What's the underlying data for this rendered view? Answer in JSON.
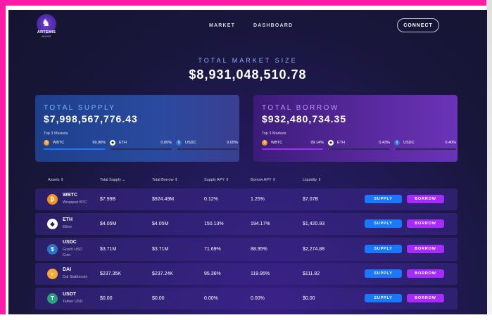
{
  "brand": {
    "name": "ARTEMIS",
    "sub": "ADLANT"
  },
  "nav": {
    "market": "MARKET",
    "dashboard": "DASHBOARD"
  },
  "connect_label": "CONNECT",
  "total_market": {
    "label": "TOTAL MARKET SIZE",
    "value": "$8,931,048,510.78"
  },
  "supply_card": {
    "title": "TOTAL SUPPLY",
    "value": "$7,998,567,776.43",
    "top3_label": "Top 3 Markets",
    "markets": [
      {
        "name": "WBTC",
        "pct": "99.90%",
        "fill": 0.999,
        "icon": "bitcoin-icon"
      },
      {
        "name": "ETH",
        "pct": "0.05%",
        "fill": 0.0005,
        "icon": "ethereum-icon"
      },
      {
        "name": "USDC",
        "pct": "0.05%",
        "fill": 0.0005,
        "icon": "usdc-icon"
      }
    ]
  },
  "borrow_card": {
    "title": "TOTAL BORROW",
    "value": "$932,480,734.35",
    "top3_label": "Top 3 Markets",
    "markets": [
      {
        "name": "WBTC",
        "pct": "99.14%",
        "fill": 0.9914,
        "icon": "bitcoin-icon"
      },
      {
        "name": "ETH",
        "pct": "0.43%",
        "fill": 0.0043,
        "icon": "ethereum-icon"
      },
      {
        "name": "USDC",
        "pct": "0.40%",
        "fill": 0.004,
        "icon": "usdc-icon"
      }
    ]
  },
  "table": {
    "headers": [
      "Assets ⇕",
      "Total Supply ⌄",
      "Total Borrow ⇕",
      "Supply APY ⇕",
      "Borrow APY ⇕",
      "Liquidity ⇕"
    ],
    "supply_label": "SUPPLY",
    "borrow_label": "BORROW",
    "rows": [
      {
        "symbol": "WBTC",
        "name": "Wrapped BTC",
        "supply": "$7.99B",
        "borrow": "$924.49M",
        "supply_apy": "0.12%",
        "borrow_apy": "1.25%",
        "liquidity": "$7.07B",
        "icon": "bitcoin-icon",
        "color": "#f7931a",
        "glyph": "₿"
      },
      {
        "symbol": "ETH",
        "name": "Ether",
        "supply": "$4.05M",
        "borrow": "$4.05M",
        "supply_apy": "150.13%",
        "borrow_apy": "194.17%",
        "liquidity": "$1,420.93",
        "icon": "ethereum-icon",
        "color": "#ffffff",
        "glyph": "◆"
      },
      {
        "symbol": "USDC",
        "name": "Goerli USD Coin",
        "supply": "$3.71M",
        "borrow": "$3.71M",
        "supply_apy": "71.69%",
        "borrow_apy": "88.95%",
        "liquidity": "$2,274.88",
        "icon": "usdc-icon",
        "color": "#2775ca",
        "glyph": "$"
      },
      {
        "symbol": "DAI",
        "name": "Dai Stablecoin",
        "supply": "$237.35K",
        "borrow": "$237.24K",
        "supply_apy": "95.36%",
        "borrow_apy": "119.95%",
        "liquidity": "$111.82",
        "icon": "dai-icon",
        "color": "#f5ac37",
        "glyph": "◐"
      },
      {
        "symbol": "USDT",
        "name": "Tether USD",
        "supply": "$0.00",
        "borrow": "$0.00",
        "supply_apy": "0.00%",
        "borrow_apy": "0.00%",
        "liquidity": "$0.00",
        "icon": "tether-icon",
        "color": "#26a17b",
        "glyph": "T"
      }
    ]
  },
  "colors": {
    "accent_supply": "#1a78ff",
    "accent_borrow": "#a52bff",
    "frame": "#ff1aa8"
  }
}
